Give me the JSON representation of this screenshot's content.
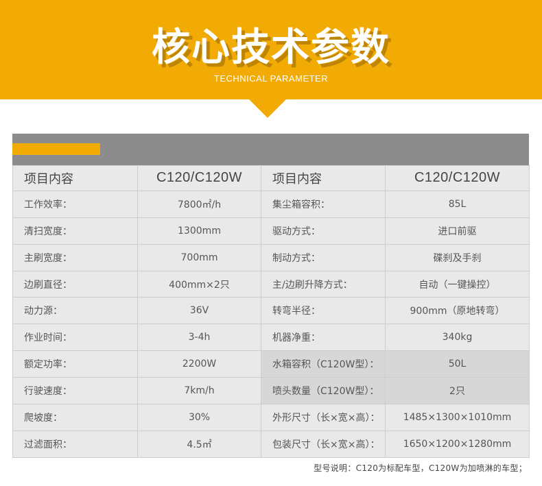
{
  "header": {
    "title": "核心技术参数",
    "subtitle": "TECHNICAL PARAMETER"
  },
  "colors": {
    "accent": "#f2ab05",
    "header_bar": "#8c8c8c",
    "table_bg": "#e9e9e9"
  },
  "table": {
    "col_headers": [
      "项目内容",
      "C120/C120W",
      "项目内容",
      "C120/C120W"
    ],
    "rows": [
      [
        "工作效率：",
        "7800㎡/h",
        "集尘箱容积：",
        "85L"
      ],
      [
        "清扫宽度：",
        "1300mm",
        "驱动方式：",
        "进口前驱"
      ],
      [
        "主刷宽度：",
        "700mm",
        "制动方式：",
        "碟刹及手刹"
      ],
      [
        "边刷直径：",
        "400mm×2只",
        "主/边刷升降方式：",
        "自动（一键操控）"
      ],
      [
        "动力源：",
        "36V",
        "转弯半径：",
        "900mm（原地转弯）"
      ],
      [
        "作业时间：",
        "3-4h",
        "机器净重：",
        "340kg"
      ],
      [
        "额定功率：",
        "2200W",
        "水箱容积（C120W型）：",
        "50L"
      ],
      [
        "行驶速度：",
        "7km/h",
        "喷头数量（C120W型）：",
        "2只"
      ],
      [
        "爬坡度：",
        "30%",
        "外形尺寸（长×宽×高）：",
        "1485×1300×1010mm"
      ],
      [
        "过滤面积：",
        "4.5㎡",
        "包装尺寸（长×宽×高）：",
        "1650×1200×1280mm"
      ]
    ]
  },
  "footnote": "型号说明：C120为标配车型，C120W为加喷淋的车型；"
}
